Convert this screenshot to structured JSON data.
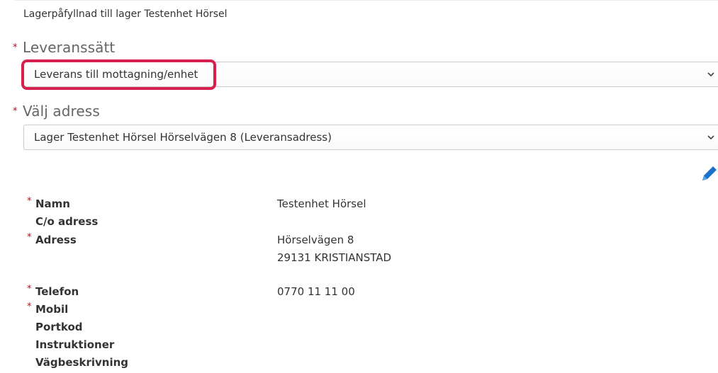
{
  "subtitle": "Lagerpåfyllnad till lager Testenhet Hörsel",
  "required_marker": "*",
  "delivery_method": {
    "label": "Leveranssätt",
    "value": "Leverans till mottagning/enhet"
  },
  "address_select": {
    "label": "Välj adress",
    "value": "Lager Testenhet Hörsel Hörselvägen 8 (Leveransadress)"
  },
  "icons": {
    "chevron": "chevron-down-icon",
    "edit": "pencil-icon"
  },
  "colors": {
    "required": "#d0021b",
    "highlight": "#d6204e",
    "edit_icon": "#1a73c9"
  },
  "details": {
    "name_label": "Namn",
    "name_value": "Testenhet Hörsel",
    "co_label": "C/o adress",
    "address_label": "Adress",
    "address_line1": "Hörselvägen 8",
    "address_line2": "29131 KRISTIANSTAD",
    "phone_label": "Telefon",
    "phone_value": "0770 11 11 00",
    "mobile_label": "Mobil",
    "portcode_label": "Portkod",
    "instructions_label": "Instruktioner",
    "directions_label": "Vägbeskrivning"
  }
}
